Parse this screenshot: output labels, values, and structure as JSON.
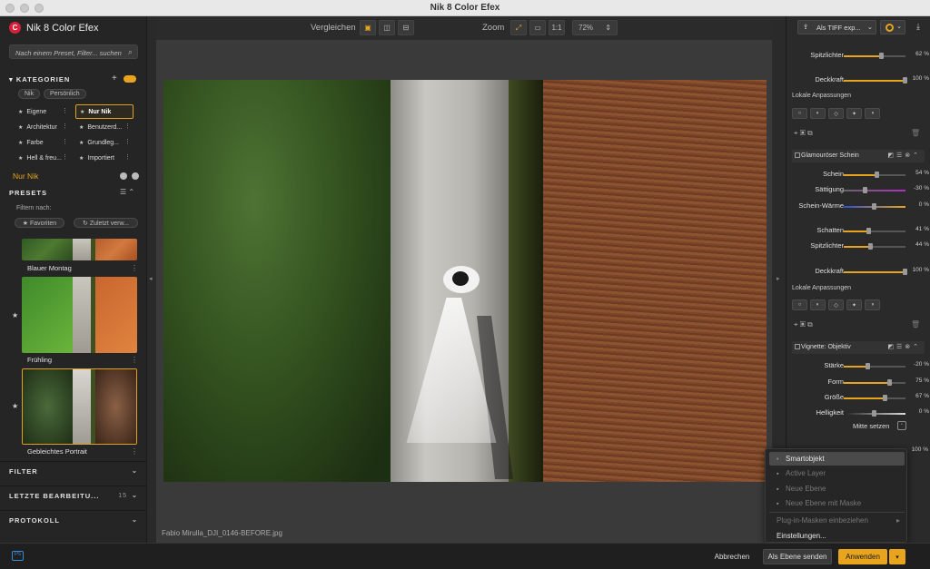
{
  "window": {
    "title": "Nik 8 Color Efex"
  },
  "app": {
    "name": "Nik 8 Color Efex"
  },
  "search": {
    "placeholder": "Nach einem Preset, Filter... suchen"
  },
  "kategorien": {
    "title": "KATEGORIEN",
    "pills": [
      "Nik",
      "Persönlich"
    ],
    "items": [
      "Eigene",
      "Nur Nik",
      "Architektur",
      "Benutzerd...",
      "Farbe",
      "Grundleg...",
      "Hell & freu...",
      "Importiert"
    ]
  },
  "nur_nik": "Nur Nik",
  "presets": {
    "title": "PRESETS",
    "filter_label": "Filtern nach:",
    "filter_pills": [
      "Favoriten",
      "Zuletzt verw..."
    ],
    "items": [
      "Blauer Montag",
      "Frühling",
      "Gebleichtes Portrait"
    ]
  },
  "collapsed": [
    {
      "label": "FILTER"
    },
    {
      "label": "LETZTE BEARBEITU...",
      "count": "15"
    },
    {
      "label": "PROTOKOLL"
    }
  ],
  "toolbar": {
    "compare": "Vergleichen",
    "zoom": "Zoom",
    "one_to_one": "1:1",
    "zoom_value": "72%"
  },
  "filename": "Fabio Mirulla_DJI_0146-BEFORE.jpg",
  "export": {
    "label": "Als TIFF exp..."
  },
  "right": {
    "top_sliders": [
      {
        "label": "Spitzlichter",
        "value": "62 %",
        "pct": 62
      },
      {
        "label": "Deckkraft",
        "value": "100 %",
        "pct": 100
      }
    ],
    "local": "Lokale Anpassungen",
    "glam": {
      "title": "Glamouröser Schein",
      "sliders": [
        {
          "label": "Schein",
          "value": "54 %",
          "pct": 54
        },
        {
          "label": "Sättigung",
          "value": "-30 %",
          "pct": 35
        },
        {
          "label": "Schein-Wärme",
          "value": "0 %",
          "pct": 50
        },
        {
          "label": "Schatten",
          "value": "41 %",
          "pct": 41
        },
        {
          "label": "Spitzlichter",
          "value": "44 %",
          "pct": 44
        },
        {
          "label": "Deckkraft",
          "value": "100 %",
          "pct": 100
        }
      ]
    },
    "vignette": {
      "title": "Vignette: Objektiv",
      "sliders": [
        {
          "label": "Stärke",
          "value": "-20 %",
          "pct": 40
        },
        {
          "label": "Form",
          "value": "75 %",
          "pct": 75
        },
        {
          "label": "Größe",
          "value": "67 %",
          "pct": 67
        },
        {
          "label": "Helligkeit",
          "value": "0 %",
          "pct": 50
        }
      ],
      "center": "Mitte setzen",
      "extra_value": "100 %"
    }
  },
  "menu": {
    "items": [
      {
        "label": "Smartobjekt",
        "state": "selected"
      },
      {
        "label": "Active Layer",
        "state": "disabled"
      },
      {
        "label": "Neue Ebene",
        "state": "disabled"
      },
      {
        "label": "Neue Ebene mit Maske",
        "state": "disabled"
      },
      {
        "label": "Plug-in-Masken einbeziehen",
        "state": "disabled"
      },
      {
        "label": "Einstellungen...",
        "state": "normal"
      }
    ]
  },
  "bottom": {
    "cancel": "Abbrechen",
    "send_layer": "Als Ebene senden",
    "apply": "Anwenden",
    "ps": "Ps"
  },
  "colors": {
    "accent": "#e8a41c",
    "brand": "#d8203a"
  }
}
